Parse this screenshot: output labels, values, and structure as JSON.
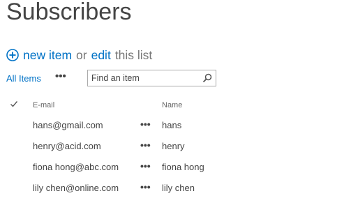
{
  "page": {
    "title": "Subscribers"
  },
  "actions": {
    "new_item": "new item",
    "or": "or",
    "edit": "edit",
    "this_list": "this list"
  },
  "view": {
    "current_view": "All Items",
    "more": "•••",
    "search_placeholder": "Find an item"
  },
  "table": {
    "columns": [
      "E-mail",
      "Name"
    ],
    "row_menu": "•••",
    "rows": [
      {
        "email": "hans@gmail.com",
        "name": "hans"
      },
      {
        "email": "henry@acid.com",
        "name": "henry"
      },
      {
        "email": "fiona hong@abc.com",
        "name": "fiona hong"
      },
      {
        "email": "lily chen@online.com",
        "name": "lily chen"
      }
    ]
  },
  "colors": {
    "link_blue": "#0072c6",
    "text": "#444444"
  },
  "icons": {
    "new_item": "plus-circle-icon",
    "search": "magnifier-icon",
    "select_all": "checkmark-icon"
  }
}
